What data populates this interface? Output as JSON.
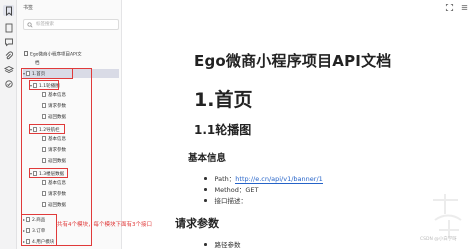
{
  "panel": {
    "title": "书签",
    "search_placeholder": "标签搜索",
    "doc_root_line1": "Ego微商小程序项目API文",
    "doc_root_line2": "档"
  },
  "outline": [
    {
      "label": "1.首页",
      "selected": true
    },
    {
      "label": "1.1轮播图"
    },
    {
      "label": "基本信息"
    },
    {
      "label": "请求参数"
    },
    {
      "label": "返回数据"
    },
    {
      "label": "1.2导航栏"
    },
    {
      "label": "基本信息"
    },
    {
      "label": "请求参数"
    },
    {
      "label": "返回数据"
    },
    {
      "label": "1.3楼层数据"
    },
    {
      "label": "基本信息"
    },
    {
      "label": "请求参数"
    },
    {
      "label": "返回数据"
    },
    {
      "label": "2.商品"
    },
    {
      "label": "3.订单"
    },
    {
      "label": "4.用户模块"
    }
  ],
  "annotation": "共有4个模块，每个模块下面有3个接口",
  "document": {
    "title": "Ego微商小程序项目API文档",
    "h1": "1.首页",
    "h2": "1.1轮播图",
    "section_basic": "基本信息",
    "path_label": "Path：",
    "path_url": "http://e.cn/api/v1/banner/1",
    "method": "Method：GET",
    "desc": "接口描述：",
    "section_params": "请求参数",
    "route_param": "路径参数"
  },
  "watermark": "CSDN @小白学呀",
  "colors": {
    "accent_red": "#e03a3a",
    "link_blue": "#2563c8",
    "selected_bg": "#d9dbe6"
  }
}
